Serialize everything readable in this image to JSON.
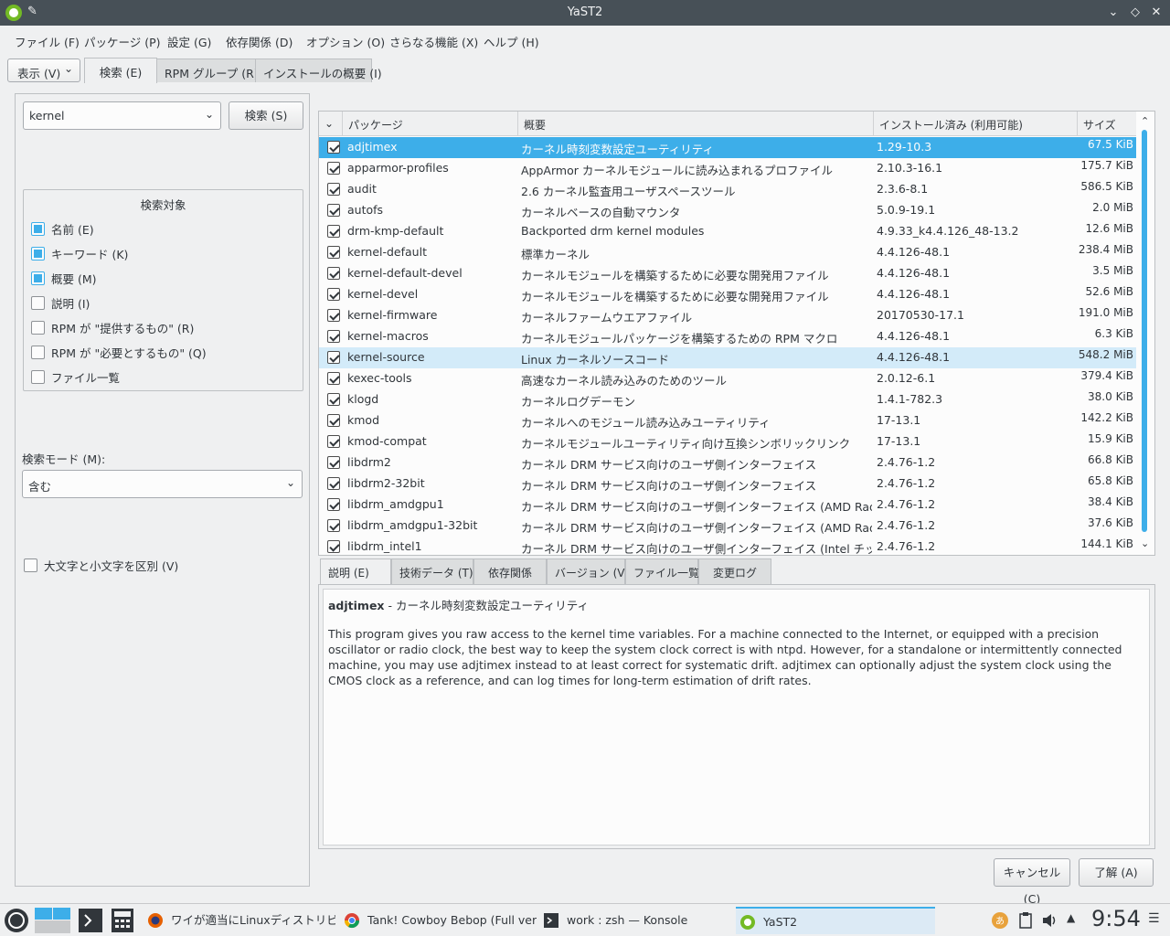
{
  "window": {
    "title": "YaST2"
  },
  "menu": [
    "ファイル (F)",
    "パッケージ (P)",
    "設定 (G)",
    "依存関係 (D)",
    "オプション (O)",
    "さらなる機能 (X)",
    "ヘルプ (H)"
  ],
  "view_button": "表示 (V)",
  "top_tabs": [
    "検索 (E)",
    "RPM グループ (R)",
    "インストールの概要 (I)"
  ],
  "search": {
    "value": "kernel",
    "button": "検索 (S)",
    "group_title": "検索対象",
    "options": [
      {
        "label": "名前 (E)",
        "checked": true
      },
      {
        "label": "キーワード (K)",
        "checked": true
      },
      {
        "label": "概要 (M)",
        "checked": true
      },
      {
        "label": "説明 (I)",
        "checked": false
      },
      {
        "label": "RPM が \"提供するもの\" (R)",
        "checked": false
      },
      {
        "label": "RPM が \"必要とするもの\" (Q)",
        "checked": false
      },
      {
        "label": "ファイル一覧",
        "checked": false
      }
    ],
    "mode_label": "検索モード (M):",
    "mode_value": "含む",
    "case_label": "大文字と小文字を区別 (V)"
  },
  "table": {
    "columns": [
      "パッケージ",
      "概要",
      "インストール済み (利用可能)",
      "サイズ"
    ],
    "rows": [
      {
        "name": "adjtimex",
        "summary": "カーネル時刻変数設定ユーティリティ",
        "version": "1.29-10.3",
        "size": "67.5 KiB"
      },
      {
        "name": "apparmor-profiles",
        "summary": "AppArmor カーネルモジュールに読み込まれるプロファイル",
        "version": "2.10.3-16.1",
        "size": "175.7 KiB"
      },
      {
        "name": "audit",
        "summary": "2.6 カーネル監査用ユーザスペースツール",
        "version": "2.3.6-8.1",
        "size": "586.5 KiB"
      },
      {
        "name": "autofs",
        "summary": "カーネルベースの自動マウンタ",
        "version": "5.0.9-19.1",
        "size": "2.0 MiB"
      },
      {
        "name": "drm-kmp-default",
        "summary": "Backported drm kernel modules",
        "version": "4.9.33_k4.4.126_48-13.2",
        "size": "12.6 MiB"
      },
      {
        "name": "kernel-default",
        "summary": "標準カーネル",
        "version": "4.4.126-48.1",
        "size": "238.4 MiB"
      },
      {
        "name": "kernel-default-devel",
        "summary": "カーネルモジュールを構築するために必要な開発用ファイル",
        "version": "4.4.126-48.1",
        "size": "3.5 MiB"
      },
      {
        "name": "kernel-devel",
        "summary": "カーネルモジュールを構築するために必要な開発用ファイル",
        "version": "4.4.126-48.1",
        "size": "52.6 MiB"
      },
      {
        "name": "kernel-firmware",
        "summary": "カーネルファームウエアファイル",
        "version": "20170530-17.1",
        "size": "191.0 MiB"
      },
      {
        "name": "kernel-macros",
        "summary": "カーネルモジュールパッケージを構築するための RPM マクロ",
        "version": "4.4.126-48.1",
        "size": "6.3 KiB"
      },
      {
        "name": "kernel-source",
        "summary": "Linux カーネルソースコード",
        "version": "4.4.126-48.1",
        "size": "548.2 MiB"
      },
      {
        "name": "kexec-tools",
        "summary": "高速なカーネル読み込みのためのツール",
        "version": "2.0.12-6.1",
        "size": "379.4 KiB"
      },
      {
        "name": "klogd",
        "summary": "カーネルログデーモン",
        "version": "1.4.1-782.3",
        "size": "38.0 KiB"
      },
      {
        "name": "kmod",
        "summary": "カーネルへのモジュール読み込みユーティリティ",
        "version": "17-13.1",
        "size": "142.2 KiB"
      },
      {
        "name": "kmod-compat",
        "summary": "カーネルモジュールユーティリティ向け互換シンボリックリンク",
        "version": "17-13.1",
        "size": "15.9 KiB"
      },
      {
        "name": "libdrm2",
        "summary": "カーネル DRM サービス向けのユーザ側インターフェイス",
        "version": "2.4.76-1.2",
        "size": "66.8 KiB"
      },
      {
        "name": "libdrm2-32bit",
        "summary": "カーネル DRM サービス向けのユーザ側インターフェイス",
        "version": "2.4.76-1.2",
        "size": "65.8 KiB"
      },
      {
        "name": "libdrm_amdgpu1",
        "summary": "カーネル DRM サービス向けのユーザ側インターフェイス (AMD Radeon ...",
        "version": "2.4.76-1.2",
        "size": "38.4 KiB"
      },
      {
        "name": "libdrm_amdgpu1-32bit",
        "summary": "カーネル DRM サービス向けのユーザ側インターフェイス (AMD Radeon ...",
        "version": "2.4.76-1.2",
        "size": "37.6 KiB"
      },
      {
        "name": "libdrm_intel1",
        "summary": "カーネル DRM サービス向けのユーザ側インターフェイス (Intel チップ用)",
        "version": "2.4.76-1.2",
        "size": "144.1 KiB"
      }
    ]
  },
  "detail_tabs": [
    "説明 (E)",
    "技術データ (T)",
    "依存関係",
    "バージョン (V)",
    "ファイル一覧",
    "変更ログ"
  ],
  "detail": {
    "name": "adjtimex",
    "summary": " - カーネル時刻変数設定ユーティリティ",
    "description": "This program gives you raw access to the kernel time variables. For a machine connected to the Internet, or equipped with a precision oscillator or radio clock, the best way to keep the system clock correct is with ntpd. However, for a standalone or intermittently connected machine, you may use adjtimex instead to at least correct for systematic drift. adjtimex can optionally adjust the system clock using the CMOS clock as a reference, and can log times for long-term estimation of drift rates."
  },
  "buttons": {
    "cancel": "キャンセル (C)",
    "accept": "了解 (A)"
  },
  "taskbar": {
    "tasks": [
      "ワイが適当にLinuxディストリビュ...",
      "Tank! Cowboy Bebop (Full vers...",
      "work : zsh — Konsole",
      "YaST2"
    ],
    "clock": "9:54"
  },
  "colors": {
    "accent": "#3daee9",
    "titlebar": "#475057",
    "background": "#eff0f1"
  }
}
